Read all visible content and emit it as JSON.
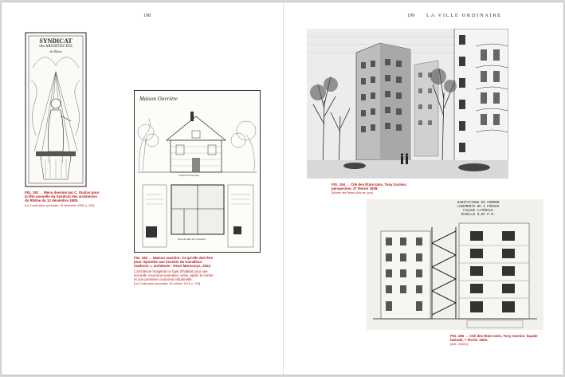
{
  "pages": {
    "left_folio": "198",
    "right_folio": "199",
    "running_head": "LA VILLE ORDINAIRE"
  },
  "figures": {
    "fig192": {
      "label": "FIG. 192",
      "arrow": "→",
      "text": "Menu dessiné par C. Duclos pour la fête annuelle du Syndicat des architectes du Rhône du 12 décembre 1908.",
      "source": "[La Construction lyonnaise, 16 décembre 1908, p. 281].",
      "poster_title_1": "SYNDICAT",
      "poster_title_2": "des ARCHITECTES",
      "poster_title_3": "du Rhône"
    },
    "fig193": {
      "label": "FIG. 193",
      "arrow": "→",
      "text": "Maison ouvrière. Ce qu'elle doit être pour répondre aux besoins du travailleur moderne », architecte : Henri Monconys, 1913.",
      "desc": "L'architecte imaginait ce type d'habitat pour une seconde couronne lyonnaise, verte, après le centre et une première couronne industrielle.",
      "source": "[La Construction lyonnaise, 16 octobre 1913, p. 316].",
      "sheet_title": "Maison Ouvrière",
      "facade_label": "Façade Principale",
      "plan_label": "Plan du Rez de Chaussée"
    },
    "fig194": {
      "label": "FIG. 194",
      "arrow": "→",
      "text": "Cité des États-Unis, Tony Garnier, perspective, 27 février 1929.",
      "source": "[Musée des Beaux-Arts de Lyon]."
    },
    "fig195": {
      "label": "FIG. 195",
      "arrow": "→",
      "text": "Cité des États-Unis, Tony Garnier, façade latérale, 7 février 1920.",
      "source": "[AML, 3300D].",
      "drawing_title_1": "HABITATIONS EN COMMUN",
      "drawing_title_2": "LOGEMENTS DE 4 PIÈCES",
      "drawing_title_3": "FAÇADE LATÉRALE",
      "drawing_scale": "ÉCHELLE 0,02 P.M."
    }
  }
}
